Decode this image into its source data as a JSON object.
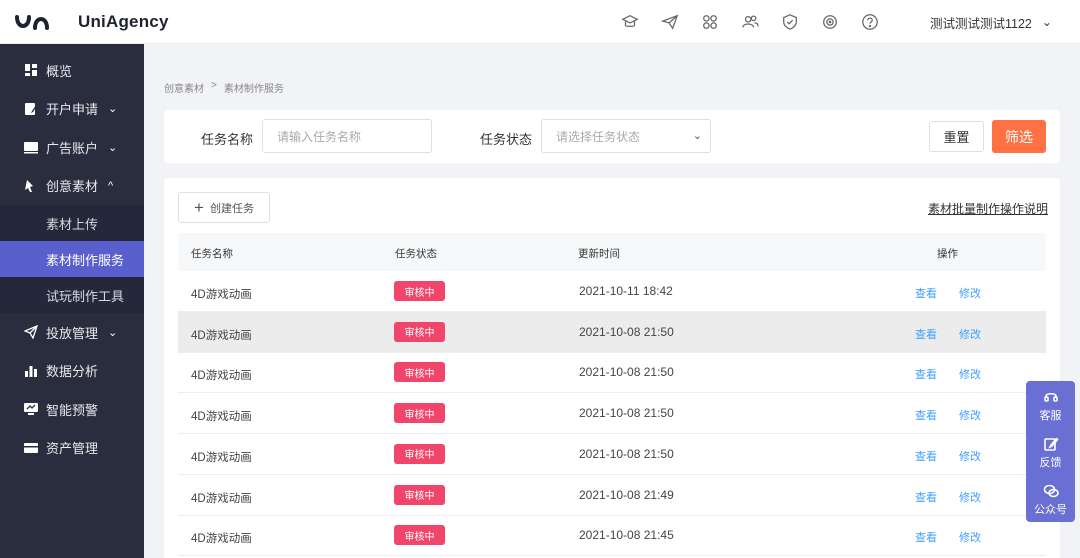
{
  "header": {
    "logo_text": "UniAgency",
    "icons": [
      "graduation-cap-icon",
      "paper-plane-icon",
      "apps-grid-icon",
      "users-icon",
      "shield-icon",
      "target-icon",
      "help-icon"
    ],
    "username": "测试测试测试1122"
  },
  "sidebar": {
    "items": [
      {
        "label": "概览",
        "icon": "dashboard-icon"
      },
      {
        "label": "开户申请",
        "icon": "edit-icon",
        "expand": "⌄"
      },
      {
        "label": "广告账户",
        "icon": "ad-icon",
        "expand": "⌄"
      },
      {
        "label": "创意素材",
        "icon": "creative-icon",
        "expand": "^"
      },
      {
        "label": "投放管理",
        "icon": "send-icon",
        "expand": "⌄"
      },
      {
        "label": "数据分析",
        "icon": "bar-chart-icon"
      },
      {
        "label": "智能预警",
        "icon": "monitor-icon"
      },
      {
        "label": "资产管理",
        "icon": "wallet-icon"
      }
    ],
    "creative_sub": [
      {
        "label": "素材上传"
      },
      {
        "label": "素材制作服务"
      },
      {
        "label": "试玩制作工具"
      }
    ]
  },
  "breadcrumb": {
    "first": "创意素材",
    "sep": ">",
    "second": "素材制作服务"
  },
  "filter": {
    "name_label": "任务名称",
    "name_placeholder": "请输入任务名称",
    "status_label": "任务状态",
    "status_placeholder": "请选择任务状态",
    "reset": "重置",
    "submit": "筛选"
  },
  "panel": {
    "create_label": "创建任务",
    "help_link": "素材批量制作操作说明",
    "columns": [
      "任务名称",
      "任务状态",
      "更新时间",
      "操作"
    ],
    "rows": [
      {
        "name": "4D游戏动画",
        "status": "审核中",
        "time": "2021-10-11 18:42",
        "view": "查看",
        "edit": "修改"
      },
      {
        "name": "4D游戏动画",
        "status": "审核中",
        "time": "2021-10-08 21:50",
        "view": "查看",
        "edit": "修改"
      },
      {
        "name": "4D游戏动画",
        "status": "审核中",
        "time": "2021-10-08 21:50",
        "view": "查看",
        "edit": "修改"
      },
      {
        "name": "4D游戏动画",
        "status": "审核中",
        "time": "2021-10-08 21:50",
        "view": "查看",
        "edit": "修改"
      },
      {
        "name": "4D游戏动画",
        "status": "审核中",
        "time": "2021-10-08 21:50",
        "view": "查看",
        "edit": "修改"
      },
      {
        "name": "4D游戏动画",
        "status": "审核中",
        "time": "2021-10-08 21:49",
        "view": "查看",
        "edit": "修改"
      },
      {
        "name": "4D游戏动画",
        "status": "审核中",
        "time": "2021-10-08 21:45",
        "view": "查看",
        "edit": "修改"
      }
    ]
  },
  "float_bar": [
    {
      "label": "客服",
      "icon": "headset-icon"
    },
    {
      "label": "反馈",
      "icon": "feedback-icon"
    },
    {
      "label": "公众号",
      "icon": "wechat-icon"
    }
  ],
  "colors": {
    "sidebar": "#2a2d3e",
    "active": "#5a5fce",
    "accent": "#ff7043",
    "status": "#f0466b",
    "link": "#409eff"
  }
}
